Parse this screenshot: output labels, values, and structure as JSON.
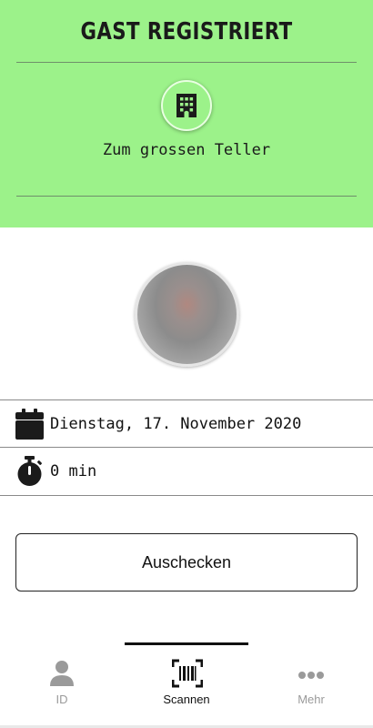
{
  "colors": {
    "accent": "#9cf28a",
    "text": "#111111",
    "muted": "#9a9a9a"
  },
  "header": {
    "title": "GAST REGISTRIERT",
    "venue_icon": "building-icon",
    "venue_name": "Zum grossen Teller"
  },
  "details": {
    "date_icon": "calendar-icon",
    "date": "Dienstag, 17. November 2020",
    "duration_icon": "stopwatch-icon",
    "duration": "0 min"
  },
  "checkout_button": {
    "label": "Auschecken"
  },
  "nav": {
    "active": "Scannen",
    "items": [
      {
        "label": "ID",
        "icon": "person-icon"
      },
      {
        "label": "Scannen",
        "icon": "barcode-scan-icon"
      },
      {
        "label": "Mehr",
        "icon": "more-icon"
      }
    ]
  }
}
